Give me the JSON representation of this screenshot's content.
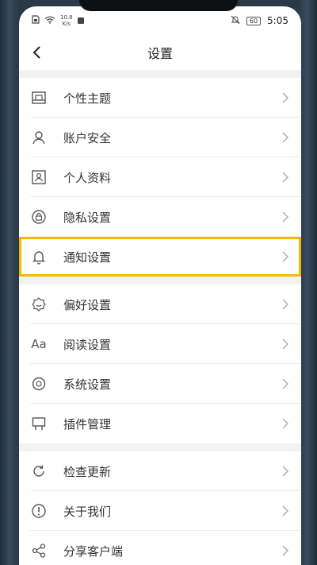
{
  "status_bar": {
    "net_speed_value": "10.8",
    "net_speed_unit": "K/s",
    "battery": "60",
    "time": "5:05"
  },
  "header": {
    "title": "设置"
  },
  "groups": [
    [
      {
        "label": "个性主题",
        "icon": "theme-icon"
      },
      {
        "label": "账户安全",
        "icon": "user-icon"
      },
      {
        "label": "个人资料",
        "icon": "profile-card-icon"
      },
      {
        "label": "隐私设置",
        "icon": "privacy-lock-icon"
      },
      {
        "label": "通知设置",
        "icon": "bell-icon",
        "highlighted": true
      }
    ],
    [
      {
        "label": "偏好设置",
        "icon": "preference-icon"
      },
      {
        "label": "阅读设置",
        "icon": "aa-text-icon",
        "icon_text": "Aa"
      },
      {
        "label": "系统设置",
        "icon": "gear-icon"
      },
      {
        "label": "插件管理",
        "icon": "plugin-icon"
      }
    ],
    [
      {
        "label": "检查更新",
        "icon": "refresh-icon"
      },
      {
        "label": "关于我们",
        "icon": "info-icon"
      },
      {
        "label": "分享客户端",
        "icon": "share-icon"
      }
    ]
  ],
  "colors": {
    "highlight": "#f5b800",
    "section_gap": "#f2f2f2"
  }
}
